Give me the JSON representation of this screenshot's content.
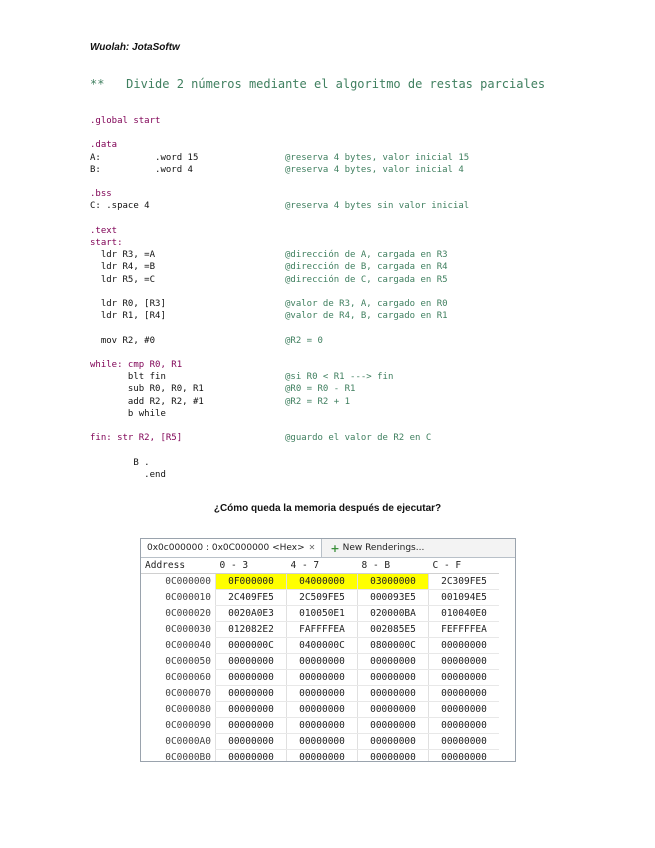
{
  "header": {
    "author": "Wuolah: JotaSoftw"
  },
  "title": "**   Divide 2 números mediante el algoritmo de restas parciales",
  "code": [
    {
      "a": ".global start",
      "b": ""
    },
    {
      "a": "",
      "b": ""
    },
    {
      "a": ".data",
      "b": ""
    },
    {
      "a": "A:          .word 15",
      "b": "@reserva 4 bytes, valor inicial 15"
    },
    {
      "a": "B:          .word 4",
      "b": "@reserva 4 bytes, valor inicial 4"
    },
    {
      "a": "",
      "b": ""
    },
    {
      "a": ".bss",
      "b": ""
    },
    {
      "a": "C: .space 4",
      "b": "@reserva 4 bytes sin valor inicial"
    },
    {
      "a": "",
      "b": ""
    },
    {
      "a": ".text",
      "b": ""
    },
    {
      "a": "start:",
      "b": ""
    },
    {
      "a": "  ldr R3, =A",
      "b": "@dirección de A, cargada en R3"
    },
    {
      "a": "  ldr R4, =B",
      "b": "@dirección de B, cargada en R4"
    },
    {
      "a": "  ldr R5, =C",
      "b": "@dirección de C, cargada en R5"
    },
    {
      "a": "",
      "b": ""
    },
    {
      "a": "  ldr R0, [R3]",
      "b": "@valor de R3, A, cargado en R0"
    },
    {
      "a": "  ldr R1, [R4]",
      "b": "@valor de R4, B, cargado en R1"
    },
    {
      "a": "",
      "b": ""
    },
    {
      "a": "  mov R2, #0",
      "b": "@R2 = 0"
    },
    {
      "a": "",
      "b": ""
    },
    {
      "a": "while: cmp R0, R1",
      "b": ""
    },
    {
      "a": "       blt fin",
      "b": "@si R0 < R1 ---> fin"
    },
    {
      "a": "       sub R0, R0, R1",
      "b": "@R0 = R0 - R1"
    },
    {
      "a": "       add R2, R2, #1",
      "b": "@R2 = R2 + 1"
    },
    {
      "a": "       b while",
      "b": ""
    },
    {
      "a": "",
      "b": ""
    },
    {
      "a": "fin: str R2, [R5]",
      "b": "@guardo el valor de R2 en C"
    },
    {
      "a": "",
      "b": ""
    },
    {
      "a": "        B .",
      "b": ""
    },
    {
      "a": "          .end",
      "b": ""
    }
  ],
  "question": "¿Cómo queda la memoria después de ejecutar?",
  "memory": {
    "tab_label": "0x0c000000 : 0x0C000000 <Hex>",
    "new_renderings": "New Renderings...",
    "columns": [
      "Address",
      "0 - 3",
      "4 - 7",
      "8 - B",
      "C - F"
    ],
    "rows": [
      [
        "0C000000",
        "0F000000",
        "04000000",
        "03000000",
        "2C309FE5"
      ],
      [
        "0C000010",
        "2C409FE5",
        "2C509FE5",
        "000093E5",
        "001094E5"
      ],
      [
        "0C000020",
        "0020A0E3",
        "010050E1",
        "020000BA",
        "010040E0"
      ],
      [
        "0C000030",
        "012082E2",
        "FAFFFFEA",
        "002085E5",
        "FEFFFFEA"
      ],
      [
        "0C000040",
        "0000000C",
        "0400000C",
        "0800000C",
        "00000000"
      ],
      [
        "0C000050",
        "00000000",
        "00000000",
        "00000000",
        "00000000"
      ],
      [
        "0C000060",
        "00000000",
        "00000000",
        "00000000",
        "00000000"
      ],
      [
        "0C000070",
        "00000000",
        "00000000",
        "00000000",
        "00000000"
      ],
      [
        "0C000080",
        "00000000",
        "00000000",
        "00000000",
        "00000000"
      ],
      [
        "0C000090",
        "00000000",
        "00000000",
        "00000000",
        "00000000"
      ],
      [
        "0C0000A0",
        "00000000",
        "00000000",
        "00000000",
        "00000000"
      ],
      [
        "0C0000B0",
        "00000000",
        "00000000",
        "00000000",
        "00000000"
      ]
    ],
    "highlight_color": "#ffff00"
  }
}
